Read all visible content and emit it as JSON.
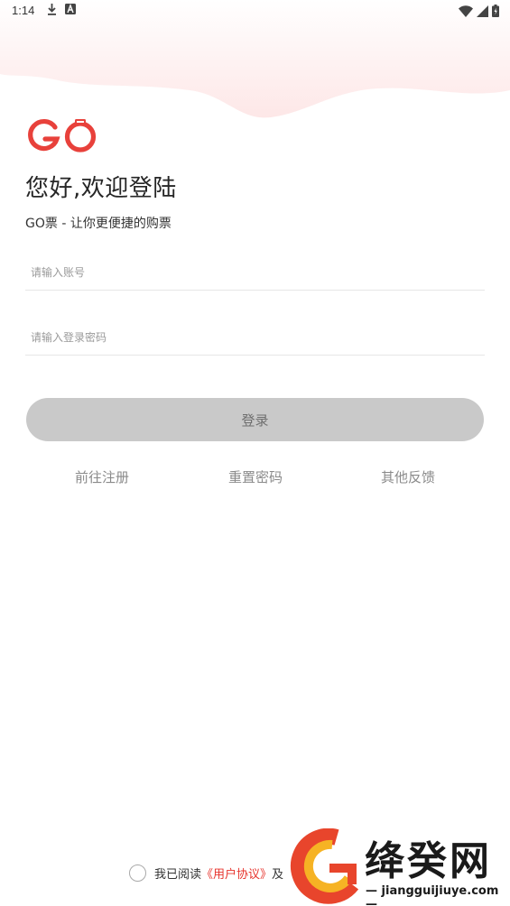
{
  "status_bar": {
    "time": "1:14",
    "left_icons": [
      "download-icon",
      "a-icon"
    ],
    "right_icons": [
      "wifi-icon",
      "signal-icon",
      "battery-icon"
    ]
  },
  "logo": {
    "alt": "GO",
    "brand_color": "#e8413b"
  },
  "greeting": "您好,欢迎登陆",
  "subtitle": "GO票 - 让你更便捷的购票",
  "form": {
    "account_placeholder": "请输入账号",
    "password_placeholder": "请输入登录密码",
    "login_label": "登录"
  },
  "links": {
    "register": "前往注册",
    "reset_password": "重置密码",
    "feedback": "其他反馈"
  },
  "agreement": {
    "prefix": "我已阅读",
    "user_agreement": "《用户协议》",
    "and": "及"
  },
  "watermark": {
    "name": "绛癸网",
    "url": "jiangguijiuye.com"
  },
  "colors": {
    "accent": "#e8413b",
    "button_disabled": "#c9c9c9",
    "link_gray": "#8a8a8a",
    "top_bg": "#fdeeee"
  }
}
